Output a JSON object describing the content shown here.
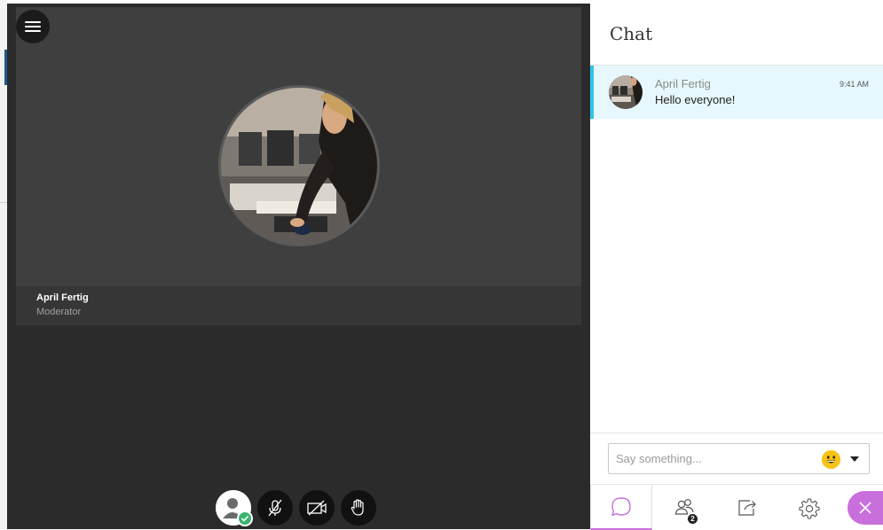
{
  "session": {
    "menu_icon": "hamburger-menu-icon",
    "tile": {
      "name": "April Fertig",
      "role": "Moderator"
    },
    "controls": [
      {
        "name": "my-status-button",
        "icon": "user-status-icon"
      },
      {
        "name": "microphone-button",
        "icon": "microphone-off-icon"
      },
      {
        "name": "camera-button",
        "icon": "camera-off-icon"
      },
      {
        "name": "raise-hand-button",
        "icon": "hand-icon"
      }
    ]
  },
  "chat": {
    "title": "Chat",
    "messages": [
      {
        "author": "April Fertig",
        "time": "9:41 AM",
        "text": "Hello everyone!"
      }
    ],
    "compose": {
      "placeholder": "Say something..."
    }
  },
  "tabs": [
    {
      "name": "chat",
      "icon": "chat-bubble-icon",
      "active": true
    },
    {
      "name": "attendees",
      "icon": "attendees-icon",
      "badge": "2"
    },
    {
      "name": "share-content",
      "icon": "share-icon"
    },
    {
      "name": "settings",
      "icon": "gear-icon"
    },
    {
      "name": "close-panel",
      "icon": "close-icon"
    }
  ],
  "colors": {
    "accent": "#c86fdc",
    "message_highlight": "#e6f8fd",
    "message_border": "#33c3e8",
    "status_ok": "#3cb371"
  }
}
